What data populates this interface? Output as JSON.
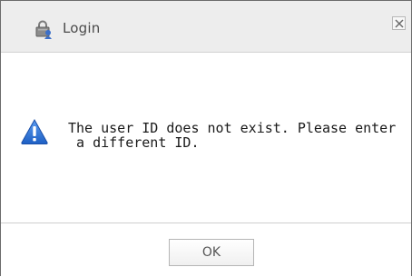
{
  "dialog": {
    "title": "Login",
    "title_icon": "lock-user-icon",
    "close_icon": "close-icon",
    "message_icon": "warning-icon",
    "message": "The user ID does not exist. Please enter\n a different ID.",
    "ok_label": "OK",
    "colors": {
      "titlebar_bg": "#ededed",
      "warning_blue": "#2a6fd6",
      "text": "#1a1a1a"
    }
  }
}
